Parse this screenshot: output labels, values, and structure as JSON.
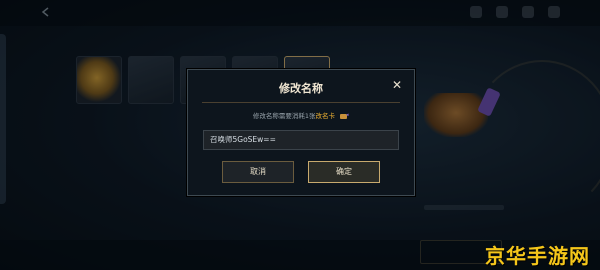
{
  "dialog": {
    "title": "修改名称",
    "close_glyph": "✕",
    "description_prefix": "修改名称需要消耗1张",
    "description_highlight": "改名卡",
    "input_value": "召唤师5GoSEw==",
    "cancel_label": "取消",
    "confirm_label": "确定"
  },
  "background": {
    "watermark": "京华手游网"
  },
  "colors": {
    "accent_gold": "#c8aa6e",
    "highlight_orange": "#f0b232",
    "dialog_bg": "#0d151d",
    "watermark_yellow": "#f5c61a"
  }
}
